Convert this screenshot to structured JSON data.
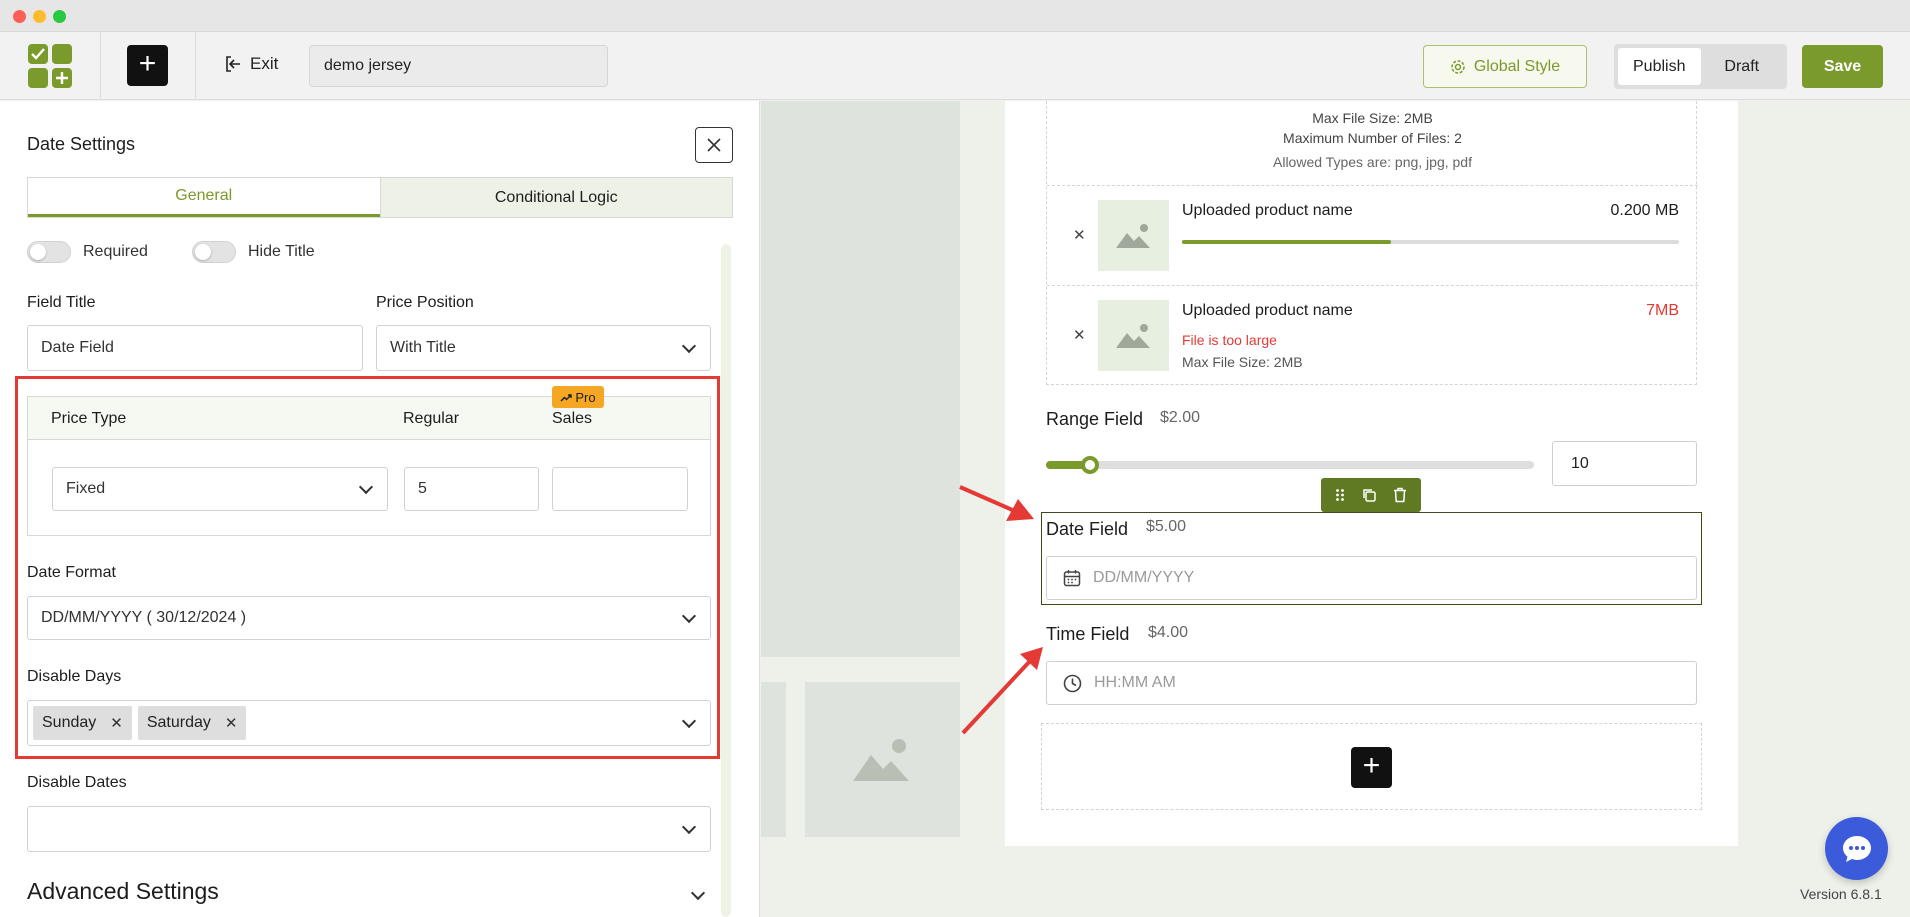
{
  "toolbar": {
    "exit_label": "Exit",
    "form_title_value": "demo jersey",
    "global_style_label": "Global Style",
    "publish_label": "Publish",
    "draft_label": "Draft",
    "save_label": "Save",
    "accent_color": "#7a9a2c"
  },
  "panel": {
    "title": "Date Settings",
    "tabs": [
      {
        "label": "General",
        "active": true
      },
      {
        "label": "Conditional Logic",
        "active": false
      }
    ],
    "required_label": "Required",
    "hide_title_label": "Hide Title",
    "field_title_label": "Field Title",
    "field_title_value": "Date Field",
    "price_position_label": "Price Position",
    "price_position_value": "With Title",
    "price_table": {
      "headers": [
        "Price Type",
        "Regular",
        "Sales"
      ],
      "pro_badge": "Pro",
      "price_type_value": "Fixed",
      "regular_value": "5",
      "sales_value": ""
    },
    "date_format_label": "Date Format",
    "date_format_value": "DD/MM/YYYY ( 30/12/2024 )",
    "disable_days_label": "Disable Days",
    "disable_days": [
      "Sunday",
      "Saturday"
    ],
    "disable_dates_label": "Disable Dates",
    "disable_dates_value": "",
    "advanced_label": "Advanced Settings"
  },
  "canvas": {
    "upload": {
      "max_file_size": "Max File Size: 2MB",
      "max_files": "Maximum Number of Files: 2",
      "allowed_types": "Allowed Types are: png, jpg, pdf",
      "files": [
        {
          "name": "Uploaded product name",
          "size": "0.200 MB",
          "progress": 0.42,
          "error": ""
        },
        {
          "name": "Uploaded product name",
          "size": "7MB",
          "error": "File is too large",
          "meta": "Max File Size: 2MB"
        }
      ]
    },
    "range_field": {
      "label": "Range Field",
      "price": "$2.00",
      "value": "10",
      "slider_fraction": 0.09
    },
    "date_field": {
      "label": "Date Field",
      "price": "$5.00",
      "placeholder": "DD/MM/YYYY"
    },
    "time_field": {
      "label": "Time Field",
      "price": "$4.00",
      "placeholder": "HH:MM AM"
    }
  },
  "version": "Version 6.8.1"
}
